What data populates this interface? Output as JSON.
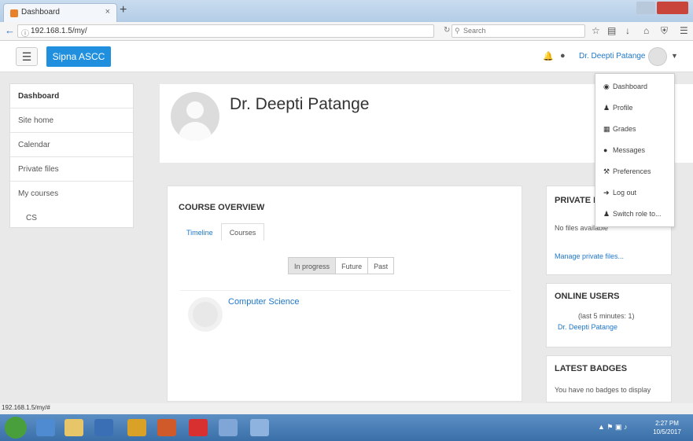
{
  "browser": {
    "tab_title": "Dashboard",
    "tab_close": "×",
    "new_tab": "+",
    "url": "192.168.1.5/my/",
    "search_placeholder": "Search"
  },
  "header": {
    "brand": "Sipna ASCC",
    "user_name": "Dr. Deepti Patange"
  },
  "left_nav": {
    "items": [
      "Dashboard",
      "Site home",
      "Calendar",
      "Private files",
      "My courses",
      "CS"
    ]
  },
  "profile": {
    "name": "Dr. Deepti Patange"
  },
  "course_overview": {
    "title": "COURSE OVERVIEW",
    "tabs": [
      "Timeline",
      "Courses"
    ],
    "filters": [
      "In progress",
      "Future",
      "Past"
    ],
    "course_name": "Computer Science"
  },
  "private_files": {
    "title": "PRIVATE FILES",
    "text": "No files available",
    "link": "Manage private files..."
  },
  "online_users": {
    "title": "ONLINE USERS",
    "subtitle": "(last 5 minutes: 1)",
    "user": "Dr. Deepti Patange"
  },
  "latest_badges": {
    "title": "LATEST BADGES",
    "text": "You have no badges to display"
  },
  "user_menu": {
    "items": [
      "Dashboard",
      "Profile",
      "Grades",
      "Messages",
      "Preferences",
      "Log out",
      "Switch role to..."
    ]
  },
  "status_bar": {
    "url": "192.168.1.5/my/#"
  },
  "clock": {
    "time": "2:27 PM",
    "date": "10/5/2017"
  },
  "colors": {
    "accent": "#1f8fde",
    "link": "#1f77c9"
  }
}
